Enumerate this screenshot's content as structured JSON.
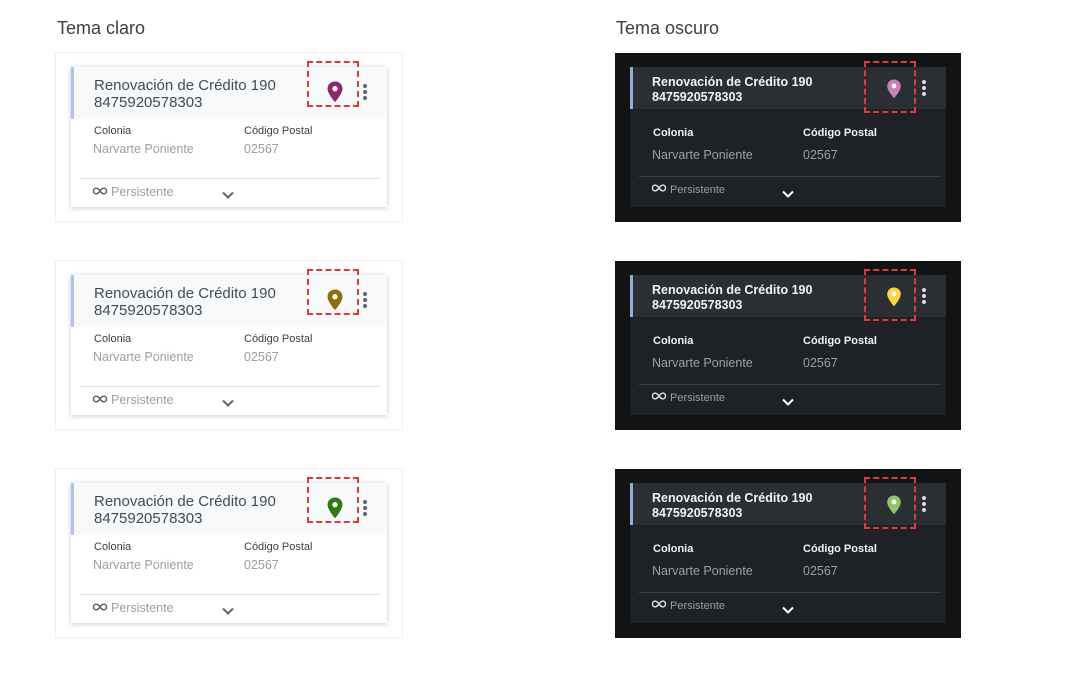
{
  "light_theme": {
    "heading": "Tema claro",
    "cards": [
      {
        "title_line1": "Renovación de Crédito 190",
        "title_line2": "8475920578303",
        "colonia_label": "Colonia",
        "colonia_value": "Narvarte Poniente",
        "cp_label": "Código Postal",
        "cp_value": "02567",
        "footer": "Persistente",
        "pin_color": "#8c2a6e"
      },
      {
        "title_line1": "Renovación de Crédito 190",
        "title_line2": "8475920578303",
        "colonia_label": "Colonia",
        "colonia_value": "Narvarte Poniente",
        "cp_label": "Código Postal",
        "cp_value": "02567",
        "footer": "Persistente",
        "pin_color": "#8b6f0f"
      },
      {
        "title_line1": "Renovación de Crédito 190",
        "title_line2": "8475920578303",
        "colonia_label": "Colonia",
        "colonia_value": "Narvarte Poniente",
        "cp_label": "Código Postal",
        "cp_value": "02567",
        "footer": "Persistente",
        "pin_color": "#2f7a14"
      }
    ]
  },
  "dark_theme": {
    "heading": "Tema oscuro",
    "cards": [
      {
        "title_line1": "Renovación de Crédito 190",
        "title_line2": "8475920578303",
        "colonia_label": "Colonia",
        "colonia_value": "Narvarte Poniente",
        "cp_label": "Código Postal",
        "cp_value": "02567",
        "footer": "Persistente",
        "pin_color": "#c77fb4"
      },
      {
        "title_line1": "Renovación de Crédito 190",
        "title_line2": "8475920578303",
        "colonia_label": "Colonia",
        "colonia_value": "Narvarte Poniente",
        "cp_label": "Código Postal",
        "cp_value": "02567",
        "footer": "Persistente",
        "pin_color": "#f9d548"
      },
      {
        "title_line1": "Renovación de Crédito 190",
        "title_line2": "8475920578303",
        "colonia_label": "Colonia",
        "colonia_value": "Narvarte Poniente",
        "cp_label": "Código Postal",
        "cp_value": "02567",
        "footer": "Persistente",
        "pin_color": "#93c26d"
      }
    ]
  },
  "icons": {
    "pin": "map-pin-icon",
    "more": "more-vertical-icon",
    "infinity": "infinity-icon",
    "expand": "chevron-down-icon"
  },
  "colors": {
    "highlight_border": "#e03a3a",
    "light_accent_bar": "#b4c0f0",
    "dark_accent_bar": "#98a7dc",
    "dark_background": "#121314"
  }
}
